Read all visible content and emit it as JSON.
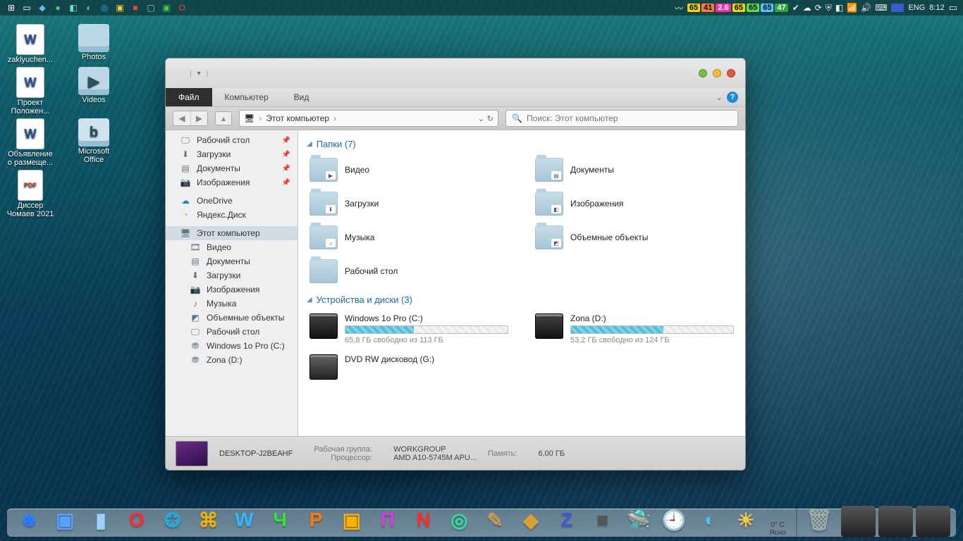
{
  "taskbar": {
    "left_icons": [
      {
        "name": "start-icon",
        "glyph": "⊞",
        "color": "#ffffff"
      },
      {
        "name": "task-view-icon",
        "glyph": "▭",
        "color": "#ffffff"
      },
      {
        "name": "tray-app-1",
        "glyph": "◆",
        "color": "#6fb7ff"
      },
      {
        "name": "tray-app-2",
        "glyph": "●",
        "color": "#4ad16a"
      },
      {
        "name": "tray-app-3",
        "glyph": "◧",
        "color": "#66e0c8"
      },
      {
        "name": "tray-app-4",
        "glyph": "◐",
        "color": "#27e8a0"
      },
      {
        "name": "edge-icon",
        "glyph": "◎",
        "color": "#3ab7e8"
      },
      {
        "name": "explorer-icon",
        "glyph": "▣",
        "color": "#ffcc33"
      },
      {
        "name": "tray-app-red",
        "glyph": "■",
        "color": "#e84b3a"
      },
      {
        "name": "tray-app-5",
        "glyph": "▢",
        "color": "#bbbbbb"
      },
      {
        "name": "tray-app-green",
        "glyph": "▣",
        "color": "#3fd43f"
      },
      {
        "name": "opera-icon",
        "glyph": "O",
        "color": "#ff3547"
      }
    ],
    "tray": {
      "feather": "〰",
      "pills": [
        {
          "text": "65",
          "bg": "#f5d400",
          "fg": "#000"
        },
        {
          "text": "41",
          "bg": "#ff7a2d",
          "fg": "#000"
        },
        {
          "text": "2.6",
          "bg": "#ff2aa6",
          "fg": "#fff"
        },
        {
          "text": "65",
          "bg": "#f5d400",
          "fg": "#000"
        },
        {
          "text": "65",
          "bg": "#57e04a",
          "fg": "#000"
        },
        {
          "text": "65",
          "bg": "#49c9ff",
          "fg": "#000"
        },
        {
          "text": "47",
          "bg": "#2aa83a",
          "fg": "#fff"
        }
      ],
      "icons": [
        {
          "name": "check-icon",
          "glyph": "✔"
        },
        {
          "name": "cloud-icon",
          "glyph": "☁"
        },
        {
          "name": "sync-icon",
          "glyph": "⟳"
        },
        {
          "name": "shield-icon",
          "glyph": "⛨"
        },
        {
          "name": "app-tray-icon",
          "glyph": "◧"
        },
        {
          "name": "wifi-icon",
          "glyph": "📶"
        },
        {
          "name": "volume-icon",
          "glyph": "🔊"
        },
        {
          "name": "keyboard-icon",
          "glyph": "⌨"
        }
      ],
      "lang": "ENG",
      "time": "8:12",
      "action_center": "▭"
    }
  },
  "desktop": [
    [
      {
        "type": "word",
        "label": "zaklyuchen..."
      },
      {
        "type": "folder",
        "label": "Photos"
      }
    ],
    [
      {
        "type": "word",
        "label": "Проект Положен..."
      },
      {
        "type": "folder",
        "label": "Videos",
        "glyph": "▶"
      }
    ],
    [
      {
        "type": "word",
        "label": "Объявление о размеще..."
      },
      {
        "type": "app",
        "label": "Microsoft Office",
        "glyph": "b"
      }
    ],
    [
      {
        "type": "pdf",
        "label": "Диссер Чомаев 2021"
      }
    ]
  ],
  "window": {
    "qat_down": "▾",
    "tabs": [
      "Файл",
      "Компьютер",
      "Вид"
    ],
    "active_tab": 0,
    "breadcrumb": {
      "icon": "🖥",
      "parts": [
        "Этот компьютер"
      ],
      "dropdown": "⌄",
      "refresh": "↻"
    },
    "search_placeholder": "Поиск: Этот компьютер",
    "sidebar_quick": [
      {
        "icon": "🖵",
        "label": "Рабочий стол",
        "pinned": true
      },
      {
        "icon": "⬇",
        "label": "Загрузки",
        "pinned": true
      },
      {
        "icon": "▤",
        "label": "Документы",
        "pinned": true
      },
      {
        "icon": "📷",
        "label": "Изображения",
        "pinned": true
      }
    ],
    "sidebar_cloud": [
      {
        "icon": "☁",
        "label": "OneDrive",
        "color": "#1b7fc4"
      },
      {
        "icon": "◔",
        "label": "Яндекс.Диск",
        "color": "#e8a300"
      }
    ],
    "sidebar_pc_label": "Этот компьютер",
    "sidebar_pc_children": [
      {
        "icon": "🎞",
        "label": "Видео"
      },
      {
        "icon": "▤",
        "label": "Документы"
      },
      {
        "icon": "⬇",
        "label": "Загрузки"
      },
      {
        "icon": "📷",
        "label": "Изображения"
      },
      {
        "icon": "♪",
        "label": "Музыка"
      },
      {
        "icon": "◩",
        "label": "Объемные объекты"
      },
      {
        "icon": "🖵",
        "label": "Рабочий стол"
      },
      {
        "icon": "⛃",
        "label": "Windows 1o Pro (C:)"
      },
      {
        "icon": "⛃",
        "label": "Zona (D:)"
      }
    ],
    "group_folders": {
      "title": "Папки (7)",
      "items": [
        {
          "label": "Видео",
          "badge": "▶"
        },
        {
          "label": "Документы",
          "badge": "▤"
        },
        {
          "label": "Загрузки",
          "badge": "⬇"
        },
        {
          "label": "Изображения",
          "badge": "◧"
        },
        {
          "label": "Музыка",
          "badge": "♪"
        },
        {
          "label": "Объемные объекты",
          "badge": "◩"
        },
        {
          "label": "Рабочий стол",
          "badge": ""
        }
      ]
    },
    "group_drives": {
      "title": "Устройства и диски (3)",
      "items": [
        {
          "label": "Windows 1o Pro (C:)",
          "sub": "65,8 ГБ свободно из 113 ГБ",
          "fill": 42
        },
        {
          "label": "Zona (D:)",
          "sub": "53,2 ГБ свободно из 124 ГБ",
          "fill": 57
        },
        {
          "label": "DVD RW дисковод (G:)",
          "sub": "",
          "kind": "dvd"
        }
      ]
    },
    "status": {
      "hostname": "DESKTOP-J2BEAHF",
      "rows": [
        {
          "k": "Рабочая группа:",
          "v": "WORKGROUP"
        },
        {
          "k": "Процессор:",
          "v": "AMD A10-5745M APU..."
        }
      ],
      "rows2": [
        {
          "k": "Память:",
          "v": "6,00 ГБ"
        }
      ]
    }
  },
  "dock": {
    "items": [
      {
        "name": "finder-icon",
        "glyph": "☻",
        "color": "#2a7cff"
      },
      {
        "name": "dock-app-1",
        "glyph": "▣",
        "color": "#5aa0ff"
      },
      {
        "name": "dock-app-2",
        "glyph": "▮",
        "color": "#9ad0ff"
      },
      {
        "name": "opera-dock-icon",
        "glyph": "O",
        "color": "#ff2b2b"
      },
      {
        "name": "dock-app-3",
        "glyph": "✪",
        "color": "#2aa6d8"
      },
      {
        "name": "dock-app-4",
        "glyph": "⌘",
        "color": "#f2b400"
      },
      {
        "name": "dock-letter-w",
        "glyph": "W",
        "color": "#33b7ff"
      },
      {
        "name": "dock-letter-ch",
        "glyph": "Ч",
        "color": "#36e236"
      },
      {
        "name": "dock-letter-r",
        "glyph": "Р",
        "color": "#ff7a00"
      },
      {
        "name": "dock-office-icon",
        "glyph": "▣",
        "color": "#ffb000"
      },
      {
        "name": "dock-letter-p",
        "glyph": "П",
        "color": "#d93bd9"
      },
      {
        "name": "dock-letter-n",
        "glyph": "N",
        "color": "#ff2a2a"
      },
      {
        "name": "dock-app-5",
        "glyph": "◎",
        "color": "#2ee0a0"
      },
      {
        "name": "dock-notes-icon",
        "glyph": "✎",
        "color": "#c79a5a"
      },
      {
        "name": "dock-app-6",
        "glyph": "◆",
        "color": "#d8a030"
      },
      {
        "name": "dock-z-icon",
        "glyph": "Z",
        "color": "#3a5ad8"
      },
      {
        "name": "dock-app-7",
        "glyph": "■",
        "color": "#555"
      },
      {
        "name": "dock-ufo-icon",
        "glyph": "🛸",
        "color": "#7bd34a"
      },
      {
        "name": "dock-clock-icon",
        "glyph": "🕘",
        "color": "#ddd"
      },
      {
        "name": "dock-app-8",
        "glyph": "◐",
        "color": "#4ac1e8"
      },
      {
        "name": "dock-weather-icon",
        "glyph": "☀",
        "color": "#f2c94c"
      }
    ],
    "weather": {
      "temp": "0° C",
      "cond": "Ясно"
    },
    "right": [
      {
        "name": "trash-icon",
        "glyph": "🗑",
        "color": "#9aa8a8"
      }
    ]
  }
}
